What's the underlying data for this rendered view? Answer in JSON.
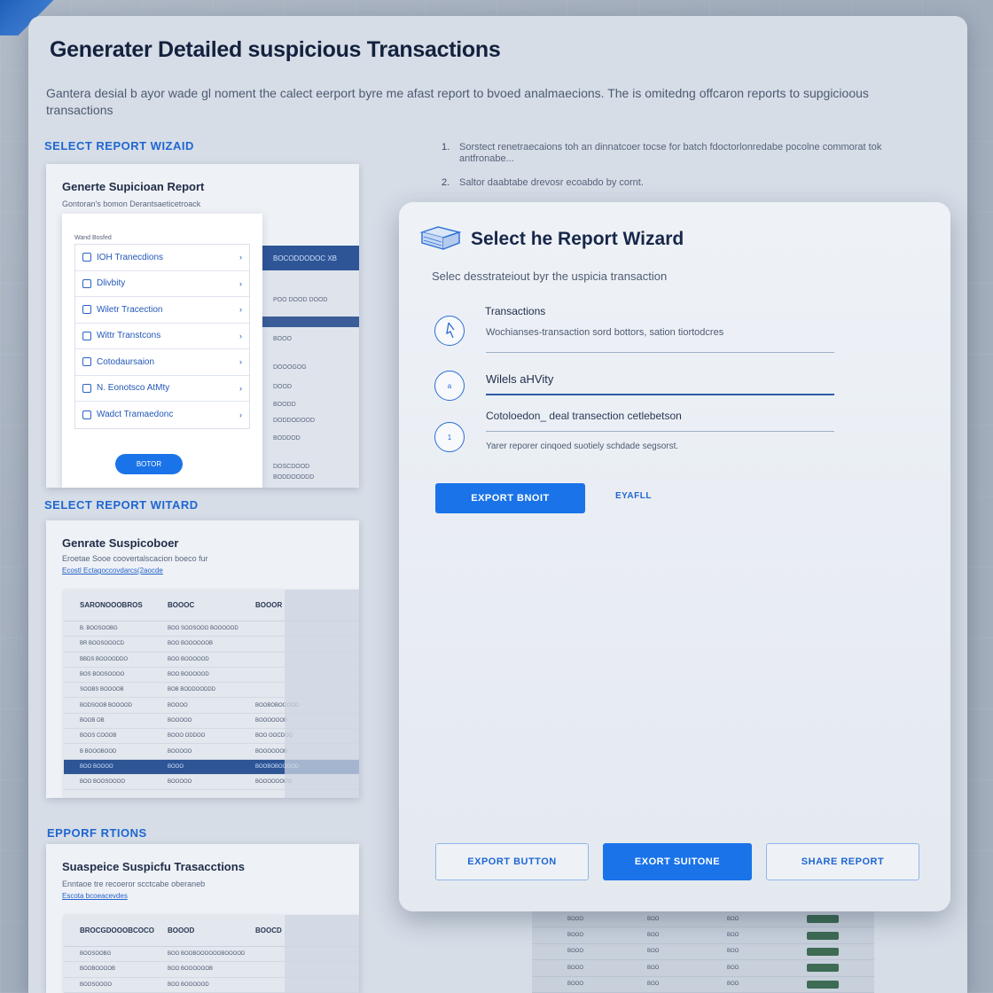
{
  "page": {
    "title": "Generater Detailed suspicious Transactions",
    "description": "Gantera desial b ayor wade gl noment the calect eerport byre me afast report to bvoed analmaecions. The is omitedng offcaron reports to supgicioous transactions"
  },
  "sections": {
    "select_wizard_1": "SELECT REPORT WIZAID",
    "select_wizard_2": "SELECT REPORT WITARD",
    "export": "EPPORF RTIONS"
  },
  "steps": [
    {
      "num": "1.",
      "text": "Sorstect renetraecaions toh an dinnatcoer tocse for batch fdoctorlonredabe pocolne commorat tok antfronabe..."
    },
    {
      "num": "2.",
      "text": "Saltor daabtabe drevosr ecoabdo by cornt."
    }
  ],
  "card1": {
    "title": "Generte Supicioan Report",
    "subtitle": "Gontoran's bomon Derantsaeticetroack",
    "menu_head": "Wand Bosfed",
    "items": [
      {
        "label": "IOH Tranecdions"
      },
      {
        "label": "Dlivbity"
      },
      {
        "label": "Wiletr Tracection"
      },
      {
        "label": "Wittr Transtcons"
      },
      {
        "label": "Cotodaursaion"
      },
      {
        "label": "N. Eonotsco AtMty"
      },
      {
        "label": "Wadct Tramaedonc"
      }
    ],
    "button": "BOTOR",
    "side_bar": "BOCODDODOC XB",
    "side_rows": [
      "POO DOOD DOOD",
      "BOOO",
      "DOOOGOG",
      "DOOD",
      "BOODD",
      "DODDODOOD",
      "BODDOD",
      "DOSCDOOD",
      "BODDOODDD"
    ]
  },
  "card2": {
    "title": "Genrate Suspicoboer",
    "subtitle": "Eroetae Sooe coovertalscacion boeco fur",
    "link": "Ecostl Ectagoccovdarcs(2aocde",
    "headers": [
      "SARONOOOBROS",
      "BOOOC",
      "BOOOR"
    ],
    "rows": [
      [
        "B. BOOSOOBG",
        "BOO SOOSOOO BOOOOOD",
        ""
      ],
      [
        "BR BOOSOOOCD",
        "BOO BOOOOOOB",
        ""
      ],
      [
        "BBDS BOOOODDO",
        "BOO BOOOOOD",
        ""
      ],
      [
        "BOS BOOSOOOO",
        "BOO BOOOOOD",
        ""
      ],
      [
        "SOOBS BOOOOB",
        "BOB BODDOODDD",
        ""
      ],
      [
        "BODSOOB BOOOOD",
        "BOOOO",
        "BOOBOBOOOOD"
      ],
      [
        "BOOB OB",
        "BOOOOO",
        "BOOOOOOB"
      ],
      [
        "BOOS COOOB",
        "BOOO ODDOO",
        "BOO OOCDOO"
      ],
      [
        "B BOOOBOOD",
        "BOOOOO",
        "BOOOOOOB"
      ],
      [
        "BOO BOOOO",
        "BOOO",
        "BOOBOBOOOOD"
      ],
      [
        "BOO BOOSOOOO",
        "BOOOOO",
        "BOOOOOOOO"
      ]
    ]
  },
  "card3": {
    "title": "Suaspeice Suspicfu Trasacctions",
    "subtitle": "Enntaoe tre recoeror scctcabe oberaneb",
    "link": "Escota bcoeacevdes",
    "headers": [
      "BROCGDOOOBCOCO",
      "BOOOD",
      "BOOCD"
    ],
    "rows": [
      [
        "BOOSOOBG",
        "BOO BOOBOOOOOOBOOOOD",
        ""
      ],
      [
        "BOOBOOOOB",
        "BOO BOOOOOOB",
        ""
      ],
      [
        "BOOSOOOO",
        "BOO BOOOOOD",
        ""
      ]
    ]
  },
  "wizard": {
    "title": "Select he Report Wizard",
    "subtitle": "Selec desstrateiout byr the uspicia transaction",
    "options": [
      {
        "title": "Transactions",
        "desc": "Wochianses-transaction sord bottors, sation tiortodcres",
        "marker": ""
      },
      {
        "title": "Wilels aHVity",
        "desc": "",
        "marker": "a"
      },
      {
        "title": "",
        "desc": "Cotoloedon_ deal transection cetlebetson",
        "marker": "1"
      }
    ],
    "note": "Yarer reporer cinqoed suotiely schdade segsorst.",
    "export_button": "EXPORT BNOIT",
    "link": "EYAFLL",
    "footer_buttons": {
      "left": "EXPORT BUTTON",
      "center": "EXORT SUITONE",
      "right": "SHARE REPORT"
    }
  },
  "ghost_table": {
    "rows": [
      [
        "BOOO",
        "BOO",
        "BOO"
      ],
      [
        "BOOO",
        "BOO",
        "BOO"
      ],
      [
        "BOOO",
        "BOO",
        "BOO"
      ],
      [
        "BOOO",
        "BOO",
        "BOO"
      ],
      [
        "BOOO",
        "BOO",
        "BOO"
      ]
    ]
  }
}
